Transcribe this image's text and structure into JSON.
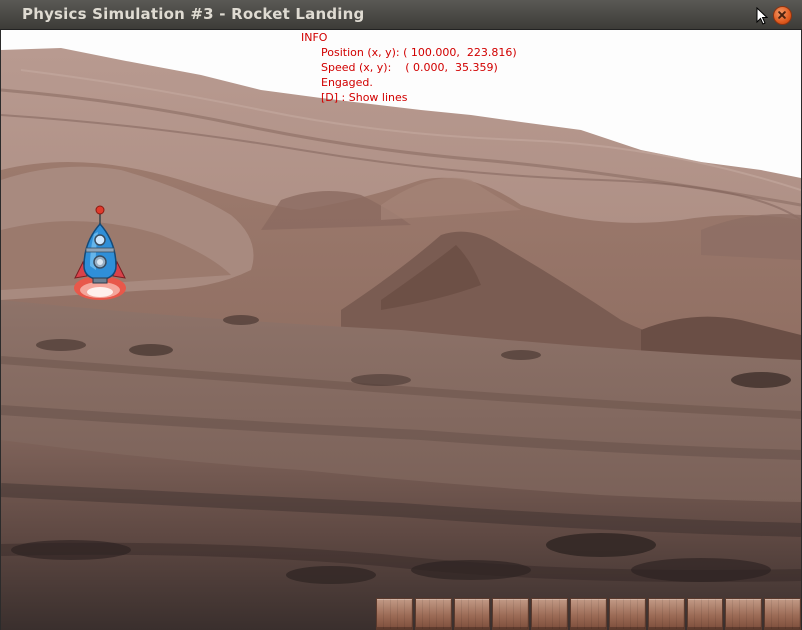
{
  "window": {
    "title": "Physics Simulation #3 - Rocket Landing"
  },
  "hud": {
    "header": "INFO",
    "position_line": "Position (x, y): ( 100.000,  223.816)",
    "speed_line": "Speed (x, y):    ( 0.000,  35.359)",
    "status_line": "Engaged.",
    "hint_line": "[D] : Show lines",
    "color": "#d10000"
  },
  "scene": {
    "background": "Mars terrain",
    "rocket": {
      "icon": "rocket-icon",
      "body_color": "#2f8fd8",
      "flame_color": "#e8584a"
    },
    "landing_pad": {
      "icon": "brick-pad",
      "brick_count": 11,
      "color": "#9c6b56"
    }
  },
  "icons": {
    "close": "close-icon",
    "cursor": "mouse-cursor-icon"
  }
}
